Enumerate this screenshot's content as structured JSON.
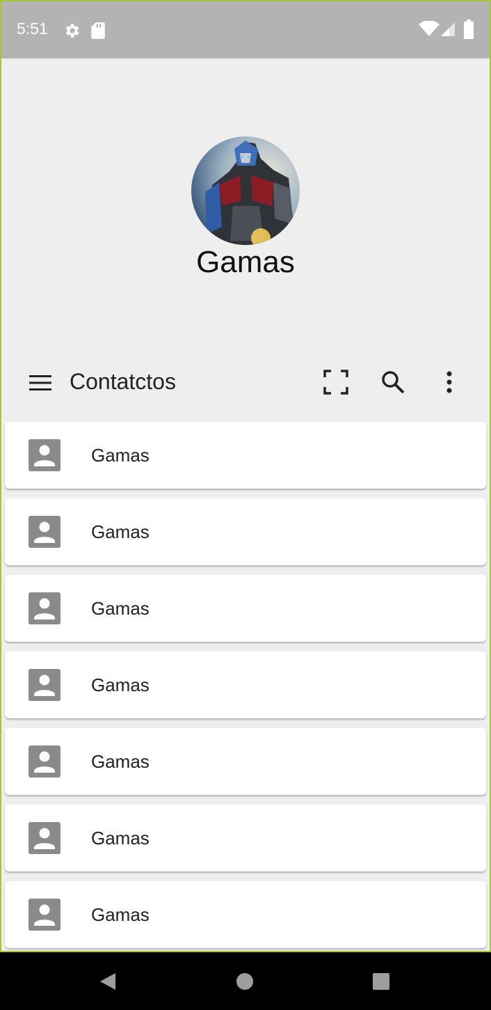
{
  "status_bar": {
    "time": "5:51",
    "icons": [
      "gear-icon",
      "sd-card-icon",
      "wifi-icon",
      "signal-icon",
      "battery-icon"
    ]
  },
  "profile": {
    "name": "Gamas",
    "avatar_description": "robot-avatar"
  },
  "toolbar": {
    "title": "Contatctos",
    "icons": [
      "menu-icon",
      "scan-icon",
      "search-icon",
      "more-vert-icon"
    ]
  },
  "contacts": [
    {
      "name": "Gamas",
      "icon": "contact-portrait-icon"
    },
    {
      "name": "Gamas",
      "icon": "contact-portrait-icon"
    },
    {
      "name": "Gamas",
      "icon": "contact-portrait-icon"
    },
    {
      "name": "Gamas",
      "icon": "contact-portrait-icon"
    },
    {
      "name": "Gamas",
      "icon": "contact-portrait-icon"
    },
    {
      "name": "Gamas",
      "icon": "contact-portrait-icon"
    },
    {
      "name": "Gamas",
      "icon": "contact-portrait-icon"
    }
  ],
  "nav_bar": {
    "icons": [
      "back-icon",
      "home-icon",
      "recents-icon"
    ]
  },
  "colors": {
    "status_bar": "#b3b3b3",
    "background": "#eeeeee",
    "card": "#ffffff",
    "frame_border": "#a4c639",
    "icon_gray": "#8a8a8a",
    "nav_bar": "#000000"
  }
}
